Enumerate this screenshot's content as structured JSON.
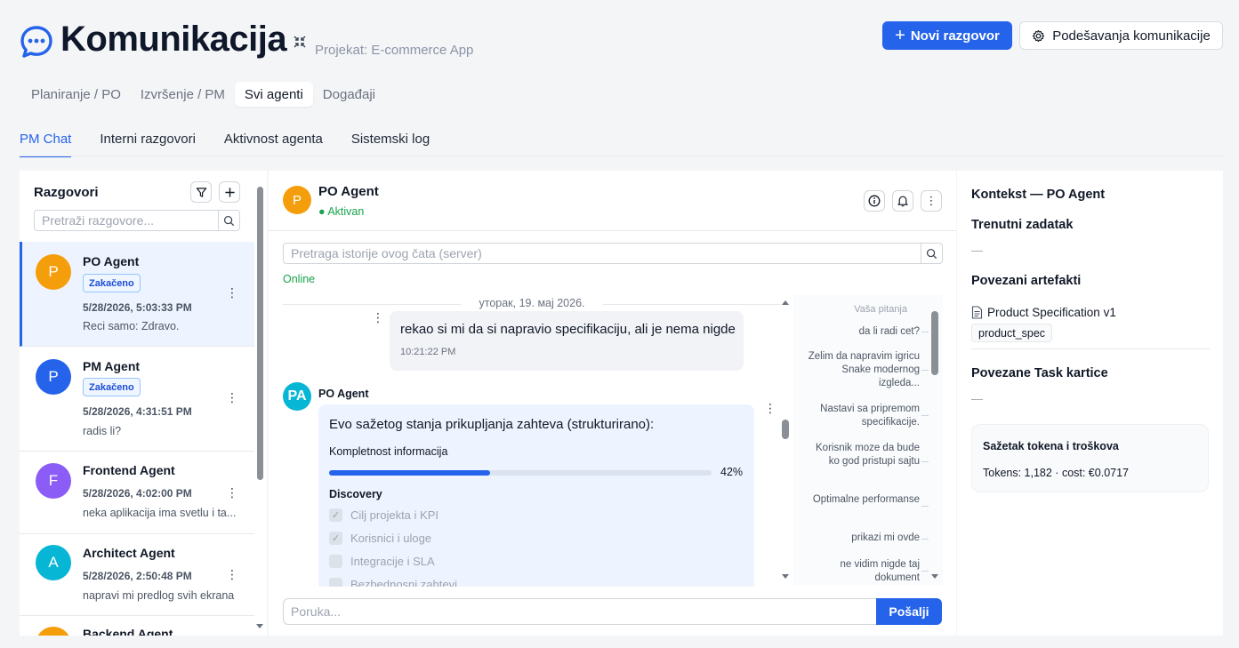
{
  "header": {
    "title": "Komunikacija",
    "project": "Projekat: E-commerce App",
    "new_button": "Novi razgovor",
    "settings_button": "Podešavanja komunikacije"
  },
  "main_tabs": [
    "Planiranje / PO",
    "Izvršenje / PM",
    "Svi agenti",
    "Događaji"
  ],
  "main_tab_active": "Svi agenti",
  "sub_tabs": [
    "PM Chat",
    "Interni razgovori",
    "Aktivnost agenta",
    "Sistemski log"
  ],
  "sub_tab_active": "PM Chat",
  "sidebar": {
    "title": "Razgovori",
    "search_placeholder": "Pretraži razgovore...",
    "conversations": [
      {
        "initial": "P",
        "name": "PO Agent",
        "badge": "Zakačeno",
        "time": "5/28/2026, 5:03:33 PM",
        "snippet": "Reci samo: Zdravo.",
        "color": "#f59e0b"
      },
      {
        "initial": "P",
        "name": "PM Agent",
        "badge": "Zakačeno",
        "time": "5/28/2026, 4:31:51 PM",
        "snippet": "radis li?",
        "color": "#2563eb"
      },
      {
        "initial": "F",
        "name": "Frontend Agent",
        "badge": "",
        "time": "5/28/2026, 4:02:00 PM",
        "snippet": "neka aplikacija ima svetlu i ta...",
        "color": "#8b5cf6"
      },
      {
        "initial": "A",
        "name": "Architect Agent",
        "badge": "",
        "time": "5/28/2026, 2:50:48 PM",
        "snippet": "napravi mi predlog svih ekrana",
        "color": "#06b6d4"
      },
      {
        "initial": "B",
        "name": "Backend Agent",
        "badge": "",
        "time": "",
        "snippet": "",
        "color": "#f59e0b"
      }
    ]
  },
  "chat": {
    "agent_initial": "P",
    "agent_name": "PO Agent",
    "status": "● Aktivan",
    "search_placeholder": "Pretraga istorije ovog čata (server)",
    "online": "Online",
    "date_separator": "уторак, 19. мај 2026.",
    "user_message": {
      "text": "rekao si mi da si napravio specifikaciju, ali je nema nigde",
      "time": "10:21:22 PM"
    },
    "agent_avatar": "PA",
    "agent_label": "PO Agent",
    "agent_message": {
      "heading": "Evo sažetog stanja prikupljanja zahteva (strukturirano):",
      "progress_label": "Kompletnost informacija",
      "progress_value": 42,
      "progress_text": "42%",
      "section": "Discovery",
      "items": [
        {
          "label": "Cilj projekta i KPI",
          "checked": true
        },
        {
          "label": "Korisnici i uloge",
          "checked": true
        },
        {
          "label": "Integracije i SLA",
          "checked": false
        },
        {
          "label": "Bezbednosni zahtevi",
          "checked": false
        }
      ]
    },
    "questions_title": "Vaša pitanja",
    "questions": [
      "da li radi cet?",
      "Zelim da napravim igricu Snake modernog izgleda...",
      "Nastavi sa pripremom specifikacije.",
      "Korisnik moze da bude ko god pristupi sajtu",
      "Optimalne performanse",
      "prikazi mi ovde",
      "ne vidim nigde taj dokument"
    ],
    "input_placeholder": "Poruka...",
    "send_label": "Pošalji"
  },
  "context": {
    "title": "Kontekst — PO Agent",
    "current_task_title": "Trenutni zadatak",
    "current_task_value": "—",
    "artifacts_title": "Povezani artefakti",
    "artifact_name": "Product Specification v1",
    "artifact_tag": "product_spec",
    "tasks_title": "Povezane Task kartice",
    "tasks_value": "—",
    "tokens_title": "Sažetak tokena i troškova",
    "tokens_value": "Tokens: 1,182 · cost: €0.0717"
  },
  "colors": {
    "accent": "#2563eb",
    "status": "#16a34a"
  }
}
